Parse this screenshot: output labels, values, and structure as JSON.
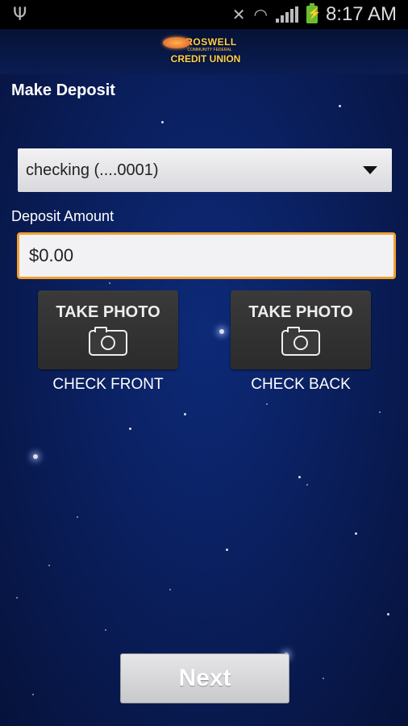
{
  "status_bar": {
    "time": "8:17 AM",
    "icons": [
      "usb-icon",
      "mute-icon",
      "wifi-icon",
      "signal-icon",
      "battery-charging-icon"
    ]
  },
  "header": {
    "logo_line1": "ROSWELL",
    "logo_line2": "COMMUNITY FEDERAL",
    "logo_line3": "CREDIT UNION"
  },
  "page": {
    "title": "Make Deposit"
  },
  "account": {
    "selected": "checking (....0001)"
  },
  "deposit": {
    "label": "Deposit Amount",
    "value": "$0.00"
  },
  "photos": [
    {
      "button_label": "TAKE PHOTO",
      "caption": "CHECK FRONT"
    },
    {
      "button_label": "TAKE PHOTO",
      "caption": "CHECK BACK"
    }
  ],
  "actions": {
    "next_label": "Next"
  },
  "colors": {
    "background": "#0a1f5e",
    "accent_focus": "#f0a030",
    "logo_gold": "#ffd14d"
  }
}
